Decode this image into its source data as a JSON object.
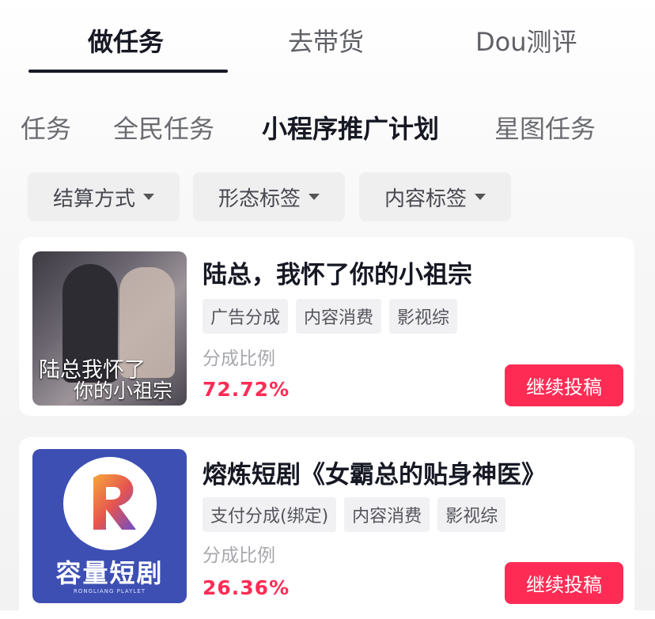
{
  "top_tabs": [
    {
      "label": "做任务",
      "active": true
    },
    {
      "label": "去带货",
      "active": false
    },
    {
      "label": "Dou测评",
      "active": false
    }
  ],
  "sub_tabs": [
    {
      "label": "任务",
      "active": false
    },
    {
      "label": "全民任务",
      "active": false
    },
    {
      "label": "小程序推广计划",
      "active": true
    },
    {
      "label": "星图任务",
      "active": false
    }
  ],
  "filters": [
    {
      "label": "结算方式"
    },
    {
      "label": "形态标签"
    },
    {
      "label": "内容标签"
    }
  ],
  "cards": [
    {
      "title": "陆总，我怀了你的小祖宗",
      "tags": [
        "广告分成",
        "内容消费",
        "影视综"
      ],
      "ratio_label": "分成比例",
      "ratio": "72.72%",
      "button": "继续投稿",
      "thumb_text_1": "陆总我怀了",
      "thumb_text_2": "你的小祖宗"
    },
    {
      "title": "熔炼短剧《女霸总的贴身神医》",
      "tags": [
        "支付分成(绑定)",
        "内容消费",
        "影视综"
      ],
      "ratio_label": "分成比例",
      "ratio": "26.36%",
      "button": "继续投稿",
      "thumb_brand": "容量短剧",
      "thumb_sub": "RONGLIANG PLAYLET"
    }
  ],
  "colors": {
    "accent": "#fe2c55",
    "text_primary": "#161823",
    "thumb_brand_bg": "#3d4fb3"
  }
}
